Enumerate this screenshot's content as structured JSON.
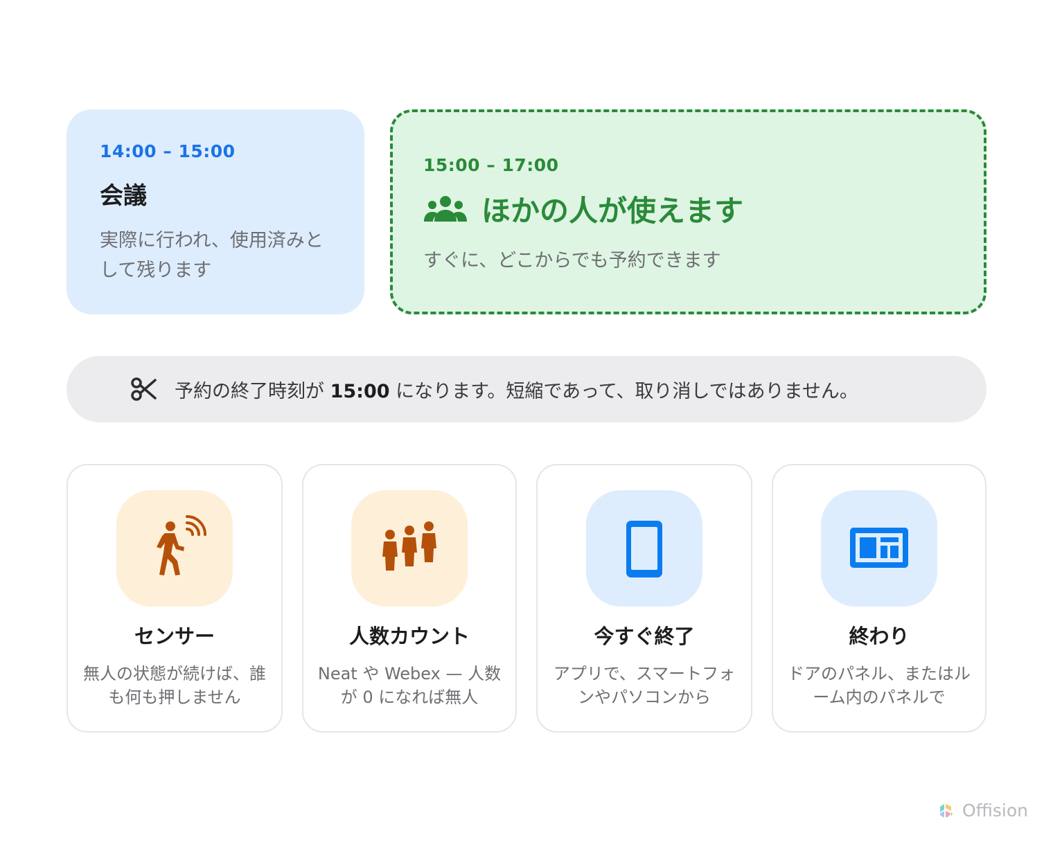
{
  "used_card": {
    "time": "14:00 – 15:00",
    "title": "会議",
    "desc": "実際に行われ、使用済みとして残ります"
  },
  "free_card": {
    "time": "15:00 – 17:00",
    "title": "ほかの人が使えます",
    "desc": "すぐに、どこからでも予約できます"
  },
  "banner": {
    "text_before": "予約の終了時刻が ",
    "time": "15:00",
    "text_after": " になります。短縮であって、取り消しではありません。"
  },
  "tiles": [
    {
      "title": "センサー",
      "desc": "無人の状態が続けば、誰も何も押しません",
      "icon": "motion-sensor-icon"
    },
    {
      "title": "人数カウント",
      "desc": "Neat や Webex — 人数が 0 になれば無人",
      "icon": "people-count-icon"
    },
    {
      "title": "今すぐ終了",
      "desc": "アプリで、スマートフォンやパソコンから",
      "icon": "smartphone-icon"
    },
    {
      "title": "終わり",
      "desc": "ドアのパネル、またはルーム内のパネルで",
      "icon": "door-panel-icon"
    }
  ],
  "brand": {
    "name": "Offision"
  },
  "colors": {
    "blue_accent": "#1a73e8",
    "green_accent": "#2a8a38",
    "orange_icon": "#b5500a",
    "blue_icon": "#0a7cf0"
  }
}
